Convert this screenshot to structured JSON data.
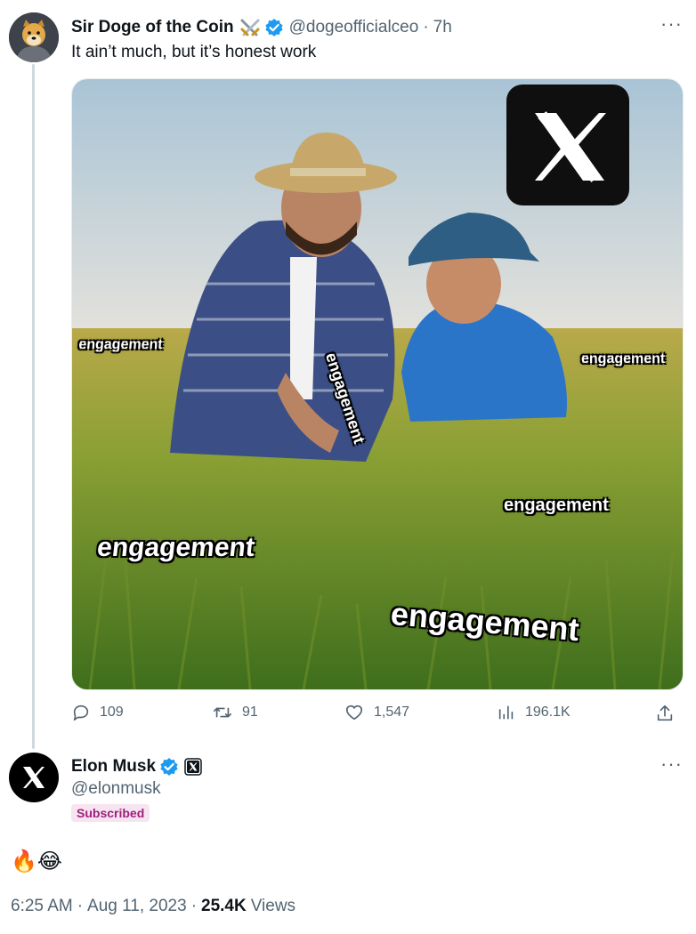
{
  "quoted_tweet": {
    "display_name": "Sir Doge of the Coin",
    "handle": "@dogeofficialceo",
    "separator": "·",
    "time": "7h",
    "text": "It ain’t much, but it’s honest work",
    "more": "···",
    "media_labels": [
      "engagement",
      "engagement",
      "engagement",
      "engagement",
      "engagement",
      "engagement"
    ],
    "stats": {
      "replies": "109",
      "retweets": "91",
      "likes": "1,547",
      "views": "196.1K"
    }
  },
  "reply": {
    "display_name": "Elon Musk",
    "handle": "@elonmusk",
    "badge": "Subscribed",
    "more": "···",
    "text": "🔥😂",
    "time": "6:25 AM",
    "separator": "·",
    "date": "Aug 11, 2023",
    "views_count": "25.4K",
    "views_label": "Views"
  },
  "colors": {
    "verified": "#1d9bf0",
    "muted": "#536471",
    "subscribed_bg": "#f7e4f1",
    "subscribed_text": "#9e1f7c"
  }
}
